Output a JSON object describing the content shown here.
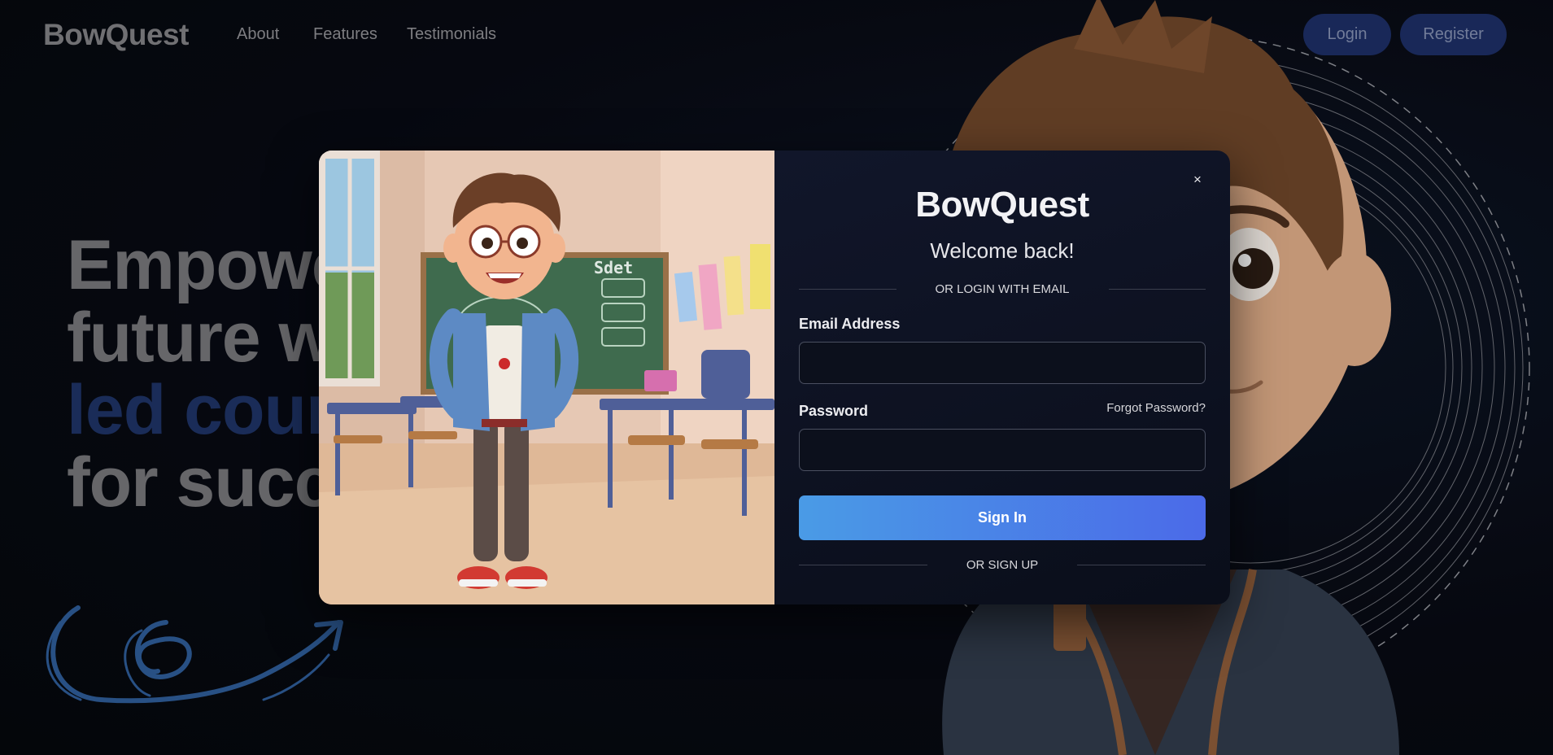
{
  "nav": {
    "logo": "BowQuest",
    "links": [
      "About",
      "Features",
      "Testimonials"
    ],
    "login_label": "Login",
    "register_label": "Register"
  },
  "hero": {
    "line1": "Empowe",
    "line2": "future w",
    "line3": "led cour",
    "line4": "for succ"
  },
  "modal": {
    "logo": "BowQuest",
    "welcome": "Welcome back!",
    "close_symbol": "×",
    "divider_login": "OR LOGIN WITH EMAIL",
    "email_label": "Email Address",
    "email_value": "",
    "password_label": "Password",
    "password_value": "",
    "forgot_label": "Forgot Password?",
    "signin_label": "Sign In",
    "divider_signup": "OR SIGN UP",
    "chalkboard_text": "Sdet"
  },
  "colors": {
    "accent_button": "#4a7fe7",
    "nav_button": "#1c2d63",
    "hero_accent": "#1e3263",
    "swirl": "#2d5a94"
  }
}
